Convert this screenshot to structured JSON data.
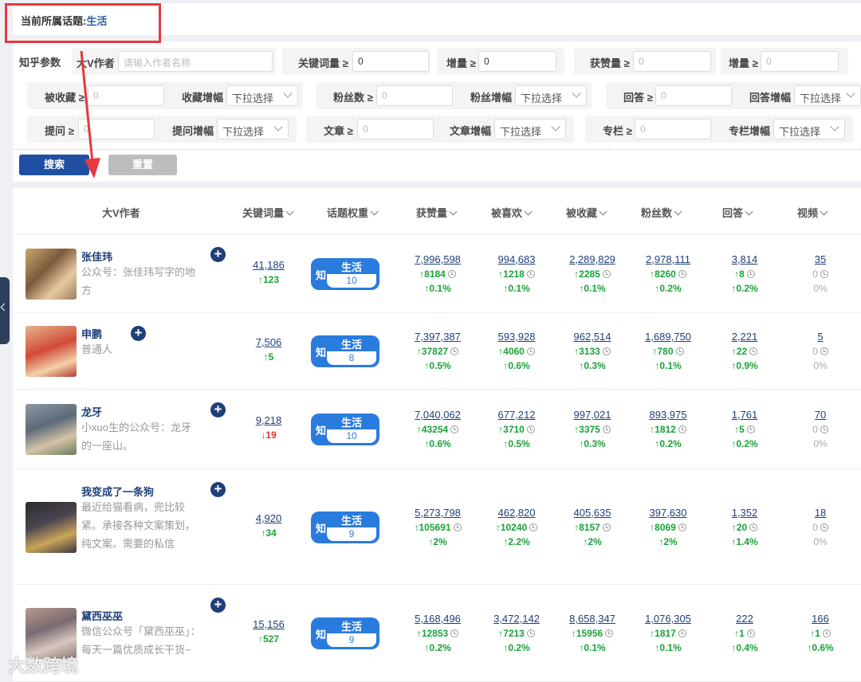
{
  "topic": {
    "label": "当前所属话题:",
    "value": "生活"
  },
  "filters": {
    "section_label": "知乎参数",
    "author_label": "大V作者",
    "author_placeholder": "请输入作者名称",
    "keyword_label": "关键词量 ≥",
    "keyword_value": "0",
    "keyword_inc_label": "增量 ≥",
    "keyword_inc_value": "0",
    "likes_label": "获赞量 ≥",
    "likes_value": "0",
    "likes_inc_label": "增量 ≥",
    "likes_inc_value": "0",
    "collected_label": "被收藏 ≥",
    "collected_value": "0",
    "collect_growth_label": "收藏增幅",
    "collect_growth_value": "下拉选择",
    "fans_label": "粉丝数 ≥",
    "fans_value": "0",
    "fans_growth_label": "粉丝增幅",
    "fans_growth_value": "下拉选择",
    "answers_label": "回答 ≥",
    "answers_value": "0",
    "answers_growth_label": "回答增幅",
    "answers_growth_value": "下拉选择",
    "questions_label": "提问 ≥",
    "questions_value": "0",
    "questions_growth_label": "提问增幅",
    "questions_growth_value": "下拉选择",
    "articles_label": "文章 ≥",
    "articles_value": "0",
    "articles_growth_label": "文章增幅",
    "articles_growth_value": "下拉选择",
    "columns_label": "专栏 ≥",
    "columns_value": "0",
    "columns_growth_label": "专栏增幅",
    "columns_growth_value": "下拉选择"
  },
  "buttons": {
    "search": "搜索",
    "reset": "重置"
  },
  "table": {
    "headers": [
      "大V作者",
      "关键词量",
      "话题权重",
      "获赞量",
      "被喜欢",
      "被收藏",
      "粉丝数",
      "回答",
      "视频"
    ],
    "badge_platform": "知",
    "rows": [
      {
        "name": "张佳玮",
        "desc": "公众号：张佳玮写字的地方",
        "keyword": "41,186",
        "keyword_delta": "123",
        "keyword_dir": "up",
        "topic": "生活",
        "weight": "10",
        "metrics": [
          {
            "value": "7,996,598",
            "delta": "8184",
            "pct": "0.1%"
          },
          {
            "value": "994,683",
            "delta": "1218",
            "pct": "0.1%"
          },
          {
            "value": "2,289,829",
            "delta": "2285",
            "pct": "0.1%"
          },
          {
            "value": "2,978,111",
            "delta": "8260",
            "pct": "0.2%"
          },
          {
            "value": "3,814",
            "delta": "8",
            "pct": "0.2%"
          },
          {
            "value": "35",
            "delta": "0",
            "pct": "0%"
          }
        ]
      },
      {
        "name": "申鹏",
        "desc": "普通人",
        "keyword": "7,506",
        "keyword_delta": "5",
        "keyword_dir": "up",
        "topic": "生活",
        "weight": "8",
        "metrics": [
          {
            "value": "7,397,387",
            "delta": "37827",
            "pct": "0.5%"
          },
          {
            "value": "593,928",
            "delta": "4060",
            "pct": "0.6%"
          },
          {
            "value": "962,514",
            "delta": "3133",
            "pct": "0.3%"
          },
          {
            "value": "1,689,750",
            "delta": "780",
            "pct": "0.1%"
          },
          {
            "value": "2,221",
            "delta": "22",
            "pct": "0.9%"
          },
          {
            "value": "5",
            "delta": "0",
            "pct": "0%"
          }
        ]
      },
      {
        "name": "龙牙",
        "desc": "小xuo生的公众号：龙牙的一座山。",
        "keyword": "9,218",
        "keyword_delta": "19",
        "keyword_dir": "down",
        "topic": "生活",
        "weight": "10",
        "metrics": [
          {
            "value": "7,040,062",
            "delta": "43254",
            "pct": "0.6%"
          },
          {
            "value": "677,212",
            "delta": "3710",
            "pct": "0.5%"
          },
          {
            "value": "997,021",
            "delta": "3375",
            "pct": "0.3%"
          },
          {
            "value": "893,975",
            "delta": "1812",
            "pct": "0.2%"
          },
          {
            "value": "1,761",
            "delta": "5",
            "pct": "0.2%"
          },
          {
            "value": "70",
            "delta": "0",
            "pct": "0%"
          }
        ]
      },
      {
        "name": "我变成了一条狗",
        "desc": "最近给猫看病，兜比较紧。承接各种文案策划，纯文案。需要的私信",
        "keyword": "4,920",
        "keyword_delta": "34",
        "keyword_dir": "up",
        "topic": "生活",
        "weight": "9",
        "metrics": [
          {
            "value": "5,273,798",
            "delta": "105691",
            "pct": "2%"
          },
          {
            "value": "462,820",
            "delta": "10240",
            "pct": "2.2%"
          },
          {
            "value": "405,635",
            "delta": "8157",
            "pct": "2%"
          },
          {
            "value": "397,630",
            "delta": "8069",
            "pct": "2%"
          },
          {
            "value": "1,352",
            "delta": "20",
            "pct": "1.4%"
          },
          {
            "value": "18",
            "delta": "0",
            "pct": "0%"
          }
        ]
      },
      {
        "name": "黛西巫巫",
        "desc": "微信公众号「黛西巫巫」：每天一篇优质成长干货~",
        "keyword": "15,156",
        "keyword_delta": "527",
        "keyword_dir": "up",
        "topic": "生活",
        "weight": "9",
        "metrics": [
          {
            "value": "5,168,496",
            "delta": "12853",
            "pct": "0.2%"
          },
          {
            "value": "3,472,142",
            "delta": "7213",
            "pct": "0.2%"
          },
          {
            "value": "8,658,347",
            "delta": "15956",
            "pct": "0.1%"
          },
          {
            "value": "1,076,305",
            "delta": "1817",
            "pct": "0.1%"
          },
          {
            "value": "222",
            "delta": "1",
            "pct": "0.4%"
          },
          {
            "value": "166",
            "delta": "1",
            "pct": "0.6%"
          }
        ]
      }
    ]
  },
  "watermark": "大数跨境"
}
